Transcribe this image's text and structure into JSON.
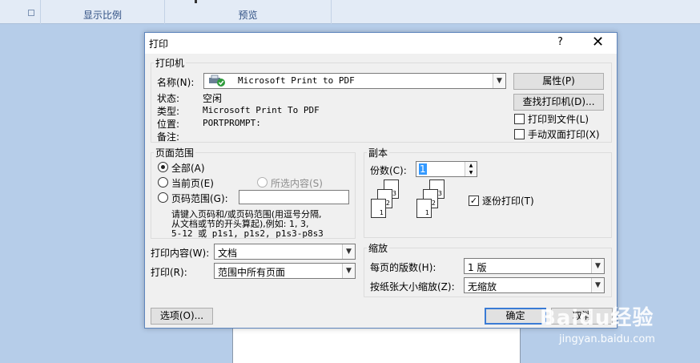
{
  "ribbon": {
    "group_zoom_label": "显示比例",
    "group_preview_label": "预览"
  },
  "dialog": {
    "title": "打印",
    "help_label": "?",
    "close_label": "✕",
    "printer": {
      "group_label": "打印机",
      "name_label": "名称(N):",
      "name_value": "Microsoft Print to PDF",
      "properties_button": "属性(P)",
      "find_printer_button": "查找打印机(D)...",
      "status_label": "状态:",
      "status_value": "空闲",
      "type_label": "类型:",
      "type_value": "Microsoft Print To PDF",
      "where_label": "位置:",
      "where_value": "PORTPROMPT:",
      "comment_label": "备注:",
      "print_to_file_label": "打印到文件(L)",
      "print_to_file_checked": false,
      "manual_duplex_label": "手动双面打印(X)",
      "manual_duplex_checked": false
    },
    "page_range": {
      "group_label": "页面范围",
      "all_label": "全部(A)",
      "current_page_label": "当前页(E)",
      "selection_label": "所选内容(S)",
      "pages_label": "页码范围(G):",
      "pages_value": "",
      "selected_option": "all",
      "hint_line1": "请键入页码和/或页码范围(用逗号分隔,",
      "hint_line2": "从文档或节的开头算起),例如: 1, 3,",
      "hint_line3": "5-12 或 p1s1, p1s2, p1s3-p8s3"
    },
    "print_what_label": "打印内容(W):",
    "print_what_value": "文档",
    "print_label": "打印(R):",
    "print_value": "范围中所有页面",
    "copies": {
      "group_label": "副本",
      "count_label": "份数(C):",
      "count_value": "1",
      "collate_label": "逐份打印(T)",
      "collate_checked": true,
      "page_digits": [
        "1",
        "2",
        "3"
      ]
    },
    "zoom": {
      "group_label": "缩放",
      "pages_per_sheet_label": "每页的版数(H):",
      "pages_per_sheet_value": "1 版",
      "scale_label": "按纸张大小缩放(Z):",
      "scale_value": "无缩放"
    },
    "options_button": "选项(O)...",
    "ok_button": "确定",
    "cancel_button": "取消"
  },
  "watermark": {
    "brand": "Baidu经验",
    "url": "jingyan.baidu.com"
  }
}
